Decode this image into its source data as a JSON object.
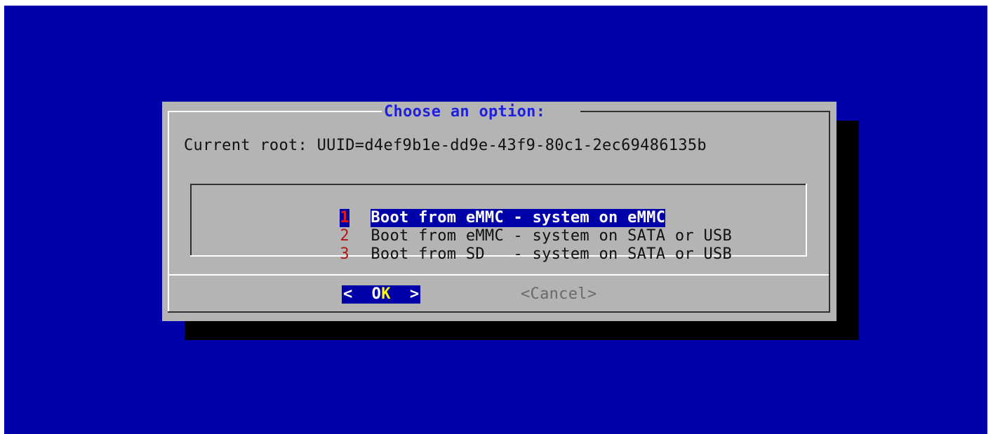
{
  "dialog": {
    "title": "Choose an option:",
    "message": "Current root: UUID=d4ef9b1e-dd9e-43f9-80c1-2ec69486135b",
    "menu": [
      {
        "tag": "1",
        "label": "Boot from eMMC - system on eMMC",
        "selected": true
      },
      {
        "tag": "2",
        "label": "Boot from eMMC - system on SATA or USB",
        "selected": false
      },
      {
        "tag": "3",
        "label": "Boot from SD   - system on SATA or USB",
        "selected": false
      }
    ],
    "buttons": {
      "ok_left": "<  O",
      "ok_hot": "K",
      "ok_right": "  >",
      "cancel": "<Cancel>"
    }
  },
  "colors": {
    "background": "#0000a8",
    "dialog": "#b4b4b4",
    "title": "#1f1fe0",
    "tag": "#b01818",
    "selection": "#0000a8",
    "hotkey": "#ffff00"
  }
}
